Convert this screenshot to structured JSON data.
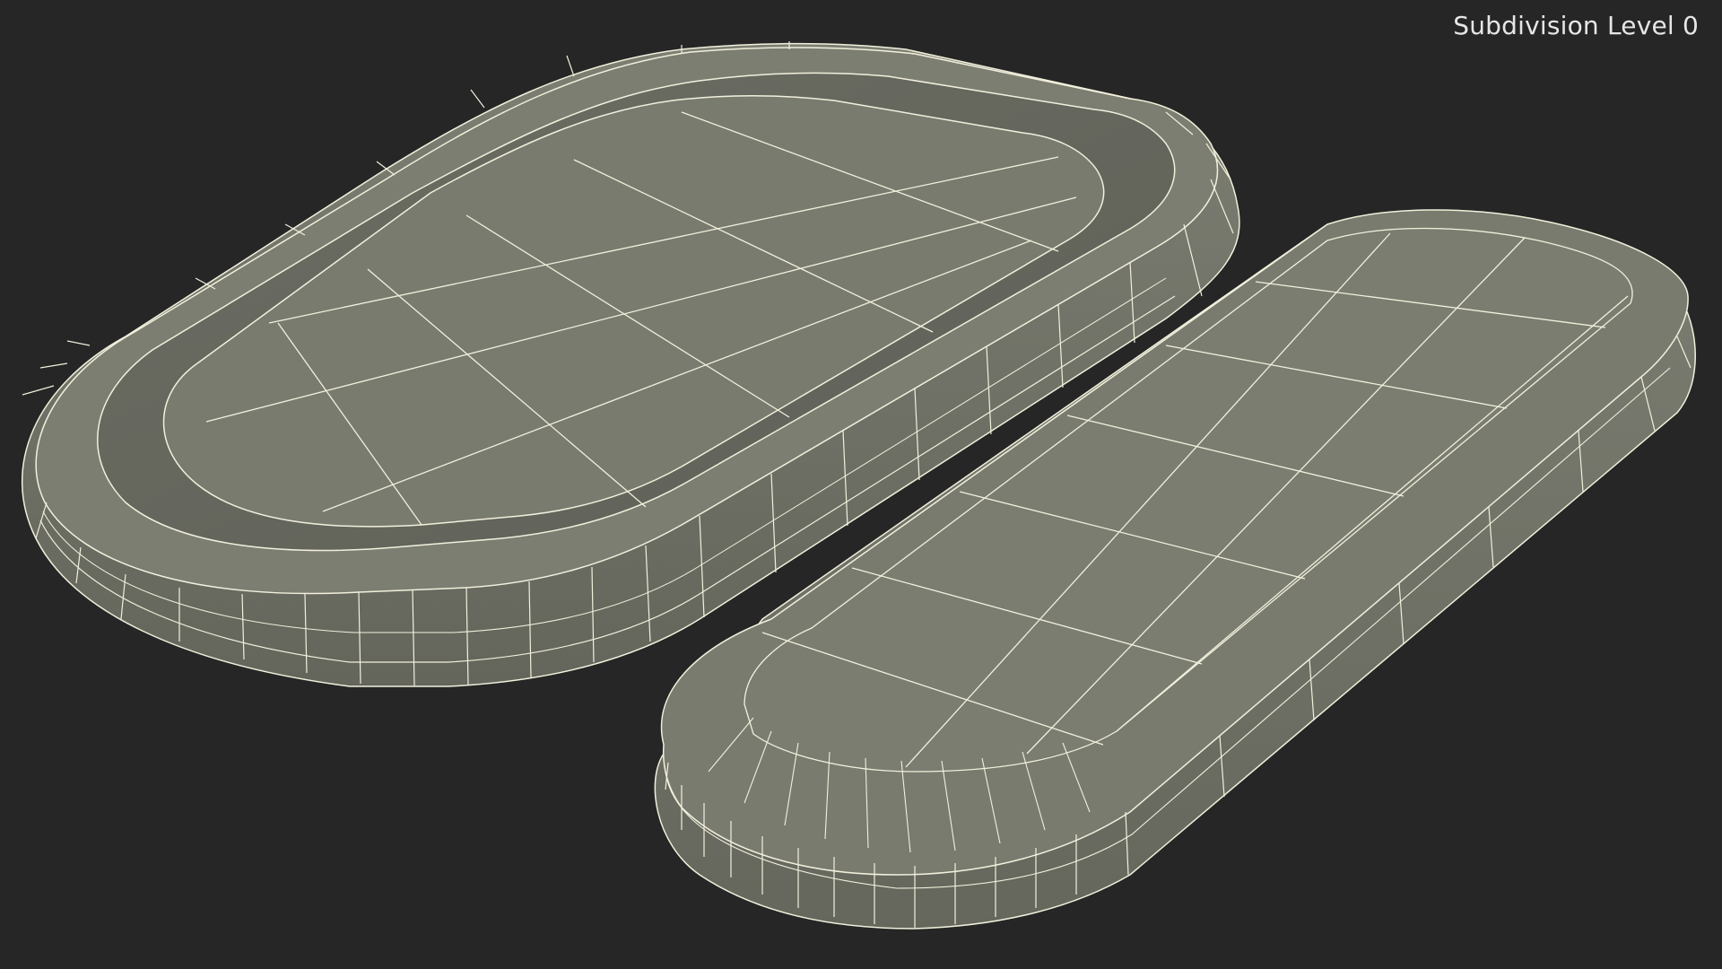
{
  "viewport": {
    "label": "Subdivision Level 0",
    "background_color": "#262626"
  },
  "model": {
    "surface_color": "#787a6e",
    "side_color": "#6f7167",
    "wire_color": "#f2f0dc"
  }
}
